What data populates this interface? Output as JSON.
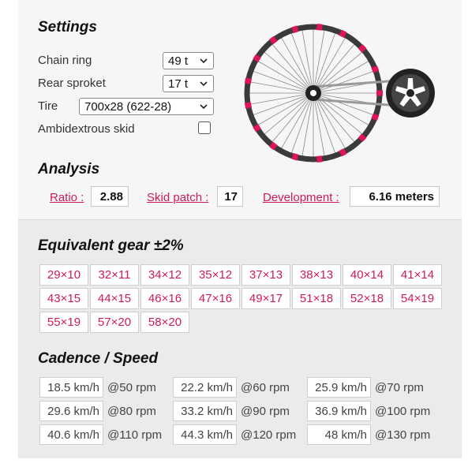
{
  "settings": {
    "title": "Settings",
    "chain_ring": {
      "label": "Chain ring",
      "value": "49 t"
    },
    "rear_sprocket": {
      "label": "Rear sproket",
      "value": "17 t"
    },
    "tire": {
      "label": "Tire",
      "value": "700x28 (622-28)"
    },
    "ambidextrous": {
      "label": "Ambidextrous skid",
      "checked": false
    }
  },
  "analysis": {
    "title": "Analysis",
    "ratio_label": "Ratio :",
    "ratio_value": "2.88",
    "skid_label": "Skid patch :",
    "skid_value": "17",
    "development_label": "Development :",
    "development_value": "6.16 meters"
  },
  "equivalent": {
    "title": "Equivalent gear ±2%",
    "gears": [
      "29×10",
      "32×11",
      "34×12",
      "35×12",
      "37×13",
      "38×13",
      "40×14",
      "41×14",
      "43×15",
      "44×15",
      "46×16",
      "47×16",
      "49×17",
      "51×18",
      "52×18",
      "54×19",
      "55×19",
      "57×20",
      "58×20"
    ]
  },
  "cadence": {
    "title": "Cadence / Speed",
    "rows": [
      {
        "speed": "18.5 km/h",
        "rpm": "@50 rpm"
      },
      {
        "speed": "22.2 km/h",
        "rpm": "@60 rpm"
      },
      {
        "speed": "25.9 km/h",
        "rpm": "@70 rpm"
      },
      {
        "speed": "29.6 km/h",
        "rpm": "@80 rpm"
      },
      {
        "speed": "33.2 km/h",
        "rpm": "@90 rpm"
      },
      {
        "speed": "36.9 km/h",
        "rpm": "@100 rpm"
      },
      {
        "speed": "40.6 km/h",
        "rpm": "@110 rpm"
      },
      {
        "speed": "44.3 km/h",
        "rpm": "@120 rpm"
      },
      {
        "speed": "48 km/h",
        "rpm": "@130 rpm"
      }
    ]
  },
  "colors": {
    "accent": "#e0135d",
    "rim": "#3a3a3a",
    "chain": "#9a9a9a"
  }
}
